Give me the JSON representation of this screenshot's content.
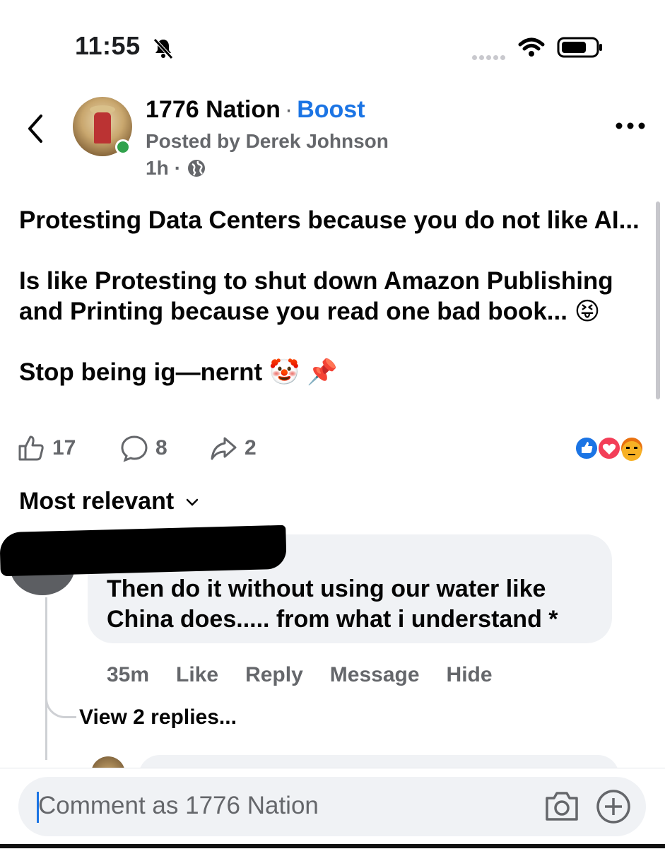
{
  "status_bar": {
    "time": "11:55"
  },
  "post": {
    "page_name": "1776 Nation",
    "separator": "·",
    "boost_label": "Boost",
    "posted_by": "Posted by Derek Johnson",
    "time_ago": "1h",
    "meta_dot": "·",
    "text": "Protesting Data Centers because you do not like AI...\n\nIs like Protesting to shut down Amazon Publishing and Printing because you read one bad book... 😝\n\nStop being ig—nernt 🤡 📌",
    "likes": "17",
    "comments": "8",
    "shares": "2",
    "reaction_icons": [
      "like-icon",
      "love-icon",
      "angry-icon"
    ]
  },
  "comments_section": {
    "sort_label": "Most relevant"
  },
  "comment": {
    "text": "Then do it without using our water like China does..... from what i understand *",
    "time_ago": "35m",
    "like_label": "Like",
    "reply_label": "Reply",
    "message_label": "Message",
    "hide_label": "Hide",
    "view_replies": "View 2 replies..."
  },
  "composer": {
    "placeholder": "Comment as 1776 Nation"
  },
  "colors": {
    "accent": "#1b74e4",
    "secondary_text": "#65676b",
    "bubble": "#f0f2f5",
    "online": "#31a24c"
  }
}
